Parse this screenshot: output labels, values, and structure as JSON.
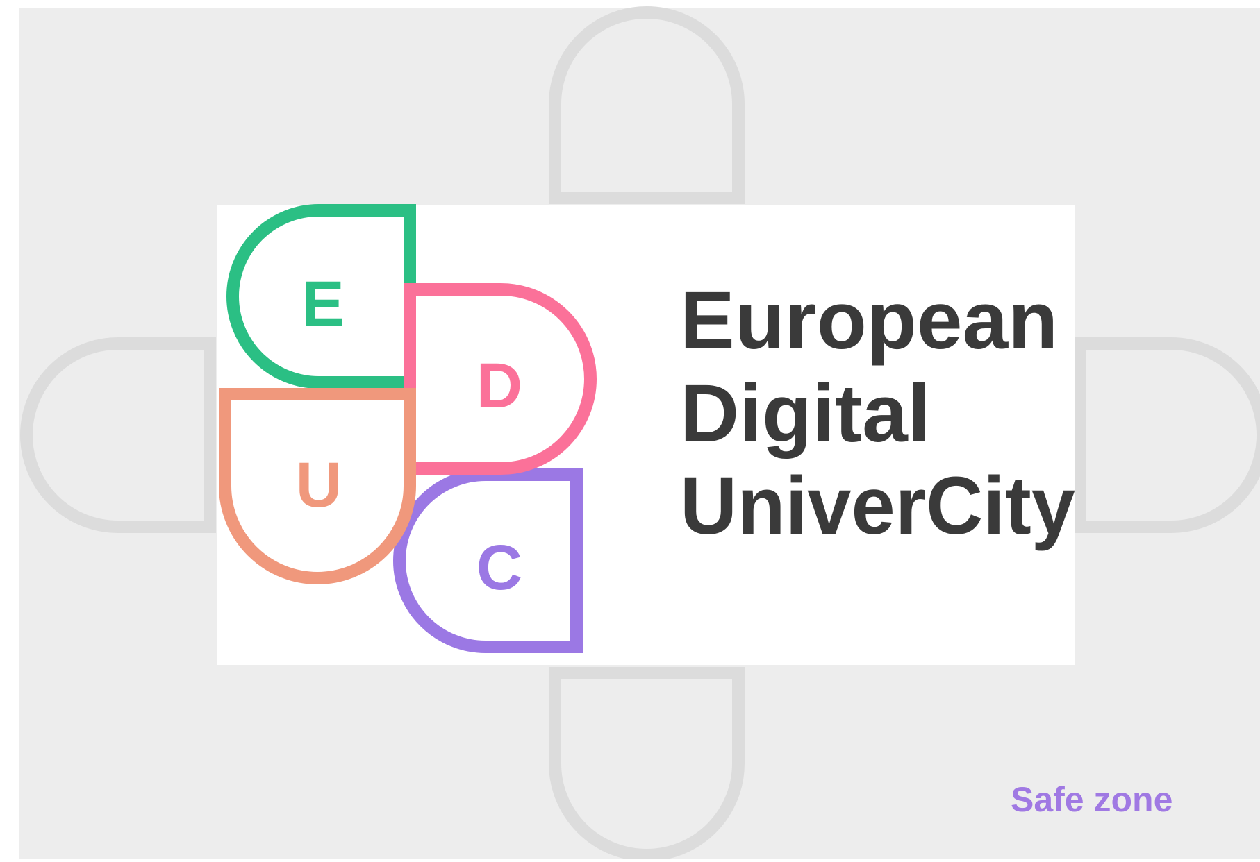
{
  "logo": {
    "letters": {
      "e": "E",
      "d": "D",
      "u": "U",
      "c": "C"
    },
    "wordmark": {
      "line1": "European",
      "line2": "Digital",
      "line3": "UniverCity"
    }
  },
  "caption": {
    "label": "Safe zone"
  },
  "colors": {
    "e": "#2bbf84",
    "d": "#fb7199",
    "u": "#f0987c",
    "c": "#9b78e4",
    "wordmark": "#3a3a3a",
    "caption": "#a079e3",
    "zone_background": "#ededed",
    "zone_outline": "#dcdcdc"
  }
}
